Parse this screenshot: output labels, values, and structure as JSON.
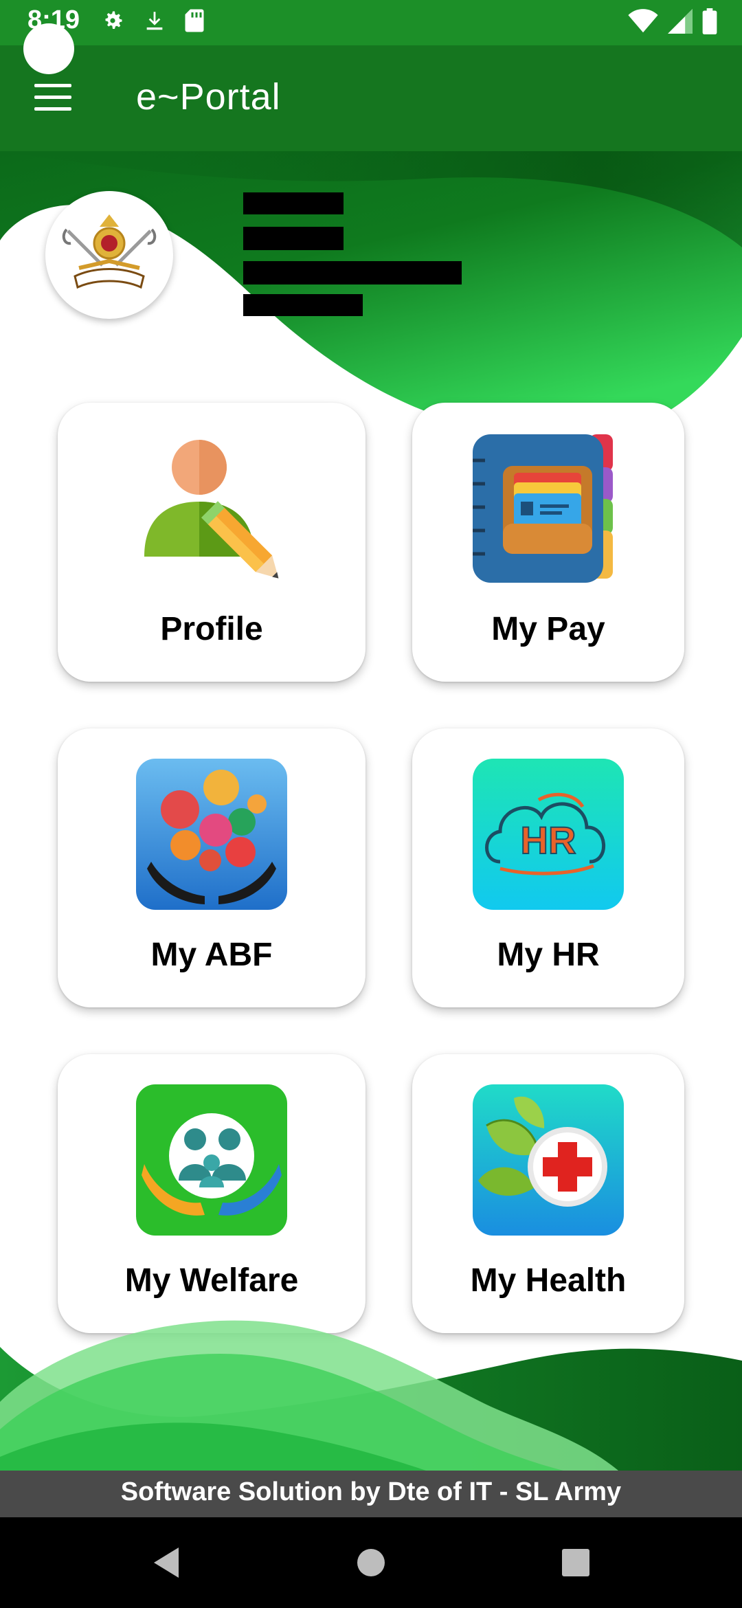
{
  "status_bar": {
    "time": "8:19",
    "icons_left": [
      "gear-icon",
      "download-icon",
      "sd-card-icon"
    ],
    "icons_right": [
      "wifi-icon",
      "signal-icon",
      "battery-icon"
    ]
  },
  "app_bar": {
    "title": "e~Portal",
    "menu_icon": "menu-icon"
  },
  "header": {
    "emblem": "sri-lanka-army-emblem",
    "user_info_redacted": true
  },
  "tiles": [
    {
      "label": "Profile",
      "icon": "profile-edit-icon"
    },
    {
      "label": "My Pay",
      "icon": "pay-book-icon"
    },
    {
      "label": "My ABF",
      "icon": "abf-hands-icon"
    },
    {
      "label": "My HR",
      "icon": "hr-cloud-icon"
    },
    {
      "label": "My Welfare",
      "icon": "welfare-family-icon"
    },
    {
      "label": "My Health",
      "icon": "health-cross-icon"
    }
  ],
  "footer": {
    "text": "Software Solution by Dte of IT - SL Army"
  },
  "nav": {
    "back": "back-icon",
    "home": "home-icon",
    "recents": "recents-icon"
  },
  "colors": {
    "primary_dark": "#15761f",
    "status": "#1c8f28",
    "accent": "#2ed455",
    "footer": "#4a4a4a"
  }
}
